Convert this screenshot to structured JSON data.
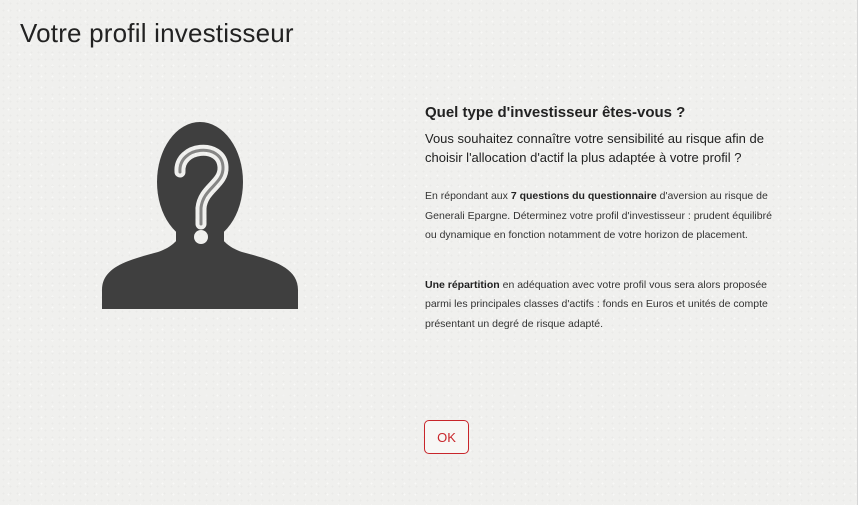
{
  "page": {
    "title": "Votre profil investisseur"
  },
  "illustration": {
    "icon": "person-question-icon",
    "color": "#3f3f3f"
  },
  "intro": {
    "question": "Quel type d'investisseur êtes-vous ?",
    "lead": "Vous souhaitez connaître votre sensibilité au risque afin de choisir l'allocation d'actif la plus adaptée à votre profil ?",
    "p1_before": "En répondant aux ",
    "p1_bold": "7 questions du questionnaire",
    "p1_after": " d'aversion au risque de Generali Epargne. Déterminez votre profil d'investisseur : prudent équilibré ou dynamique en fonction notamment de votre horizon de placement.",
    "p2_bold": "Une répartition",
    "p2_after": " en adéquation avec votre profil vous sera alors proposée parmi les principales classes d'actifs : fonds en Euros et unités de compte présentant un degré de risque adapté."
  },
  "actions": {
    "ok_label": "OK",
    "accent_color": "#c8262b"
  }
}
